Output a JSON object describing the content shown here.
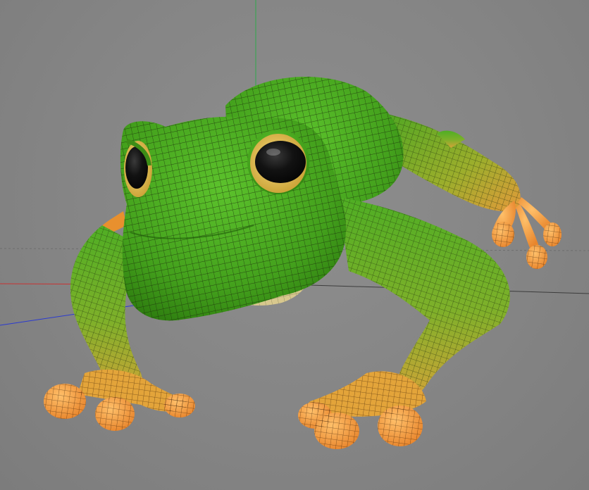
{
  "viewport": {
    "background": "#878787",
    "grid_visible": true,
    "axis_colors": {
      "x": "#c83232",
      "y": "#2fa84a",
      "z": "#2b3ad0"
    }
  },
  "model": {
    "subject": "frog",
    "display_mode": "shaded-wireframe",
    "colors": {
      "body": "#4fae24",
      "body_dark": "#2f7f10",
      "gradient_yellow": "#b7b42a",
      "toes": "#f3963a",
      "toes_light": "#ffc06a",
      "eye_ring": "#e9c45b",
      "pupil": "#141414",
      "belly": "#d3c38a",
      "wire": "#1c2a10"
    }
  }
}
